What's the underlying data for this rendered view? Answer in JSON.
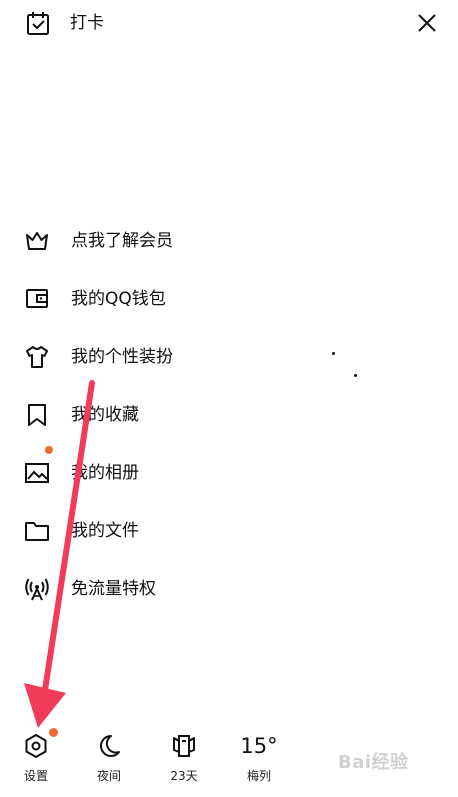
{
  "header": {
    "checkin_label": "打卡"
  },
  "menu": {
    "items": [
      {
        "label": "点我了解会员",
        "icon": "crown-icon"
      },
      {
        "label": "我的QQ钱包",
        "icon": "wallet-icon"
      },
      {
        "label": "我的个性装扮",
        "icon": "tshirt-icon"
      },
      {
        "label": "我的收藏",
        "icon": "bookmark-icon"
      },
      {
        "label": "我的相册",
        "icon": "photo-icon"
      },
      {
        "label": "我的文件",
        "icon": "folder-icon"
      },
      {
        "label": "免流量特权",
        "icon": "signal-icon"
      }
    ]
  },
  "bottombar": {
    "settings_label": "设置",
    "night_label": "夜间",
    "days_label": "23天",
    "temperature": "15°",
    "weather_label": "梅列"
  },
  "colors": {
    "accent_dot": "#f06a35",
    "arrow": "#f03c5a",
    "text": "#111111"
  },
  "watermark": {
    "text": "Bai经验"
  }
}
